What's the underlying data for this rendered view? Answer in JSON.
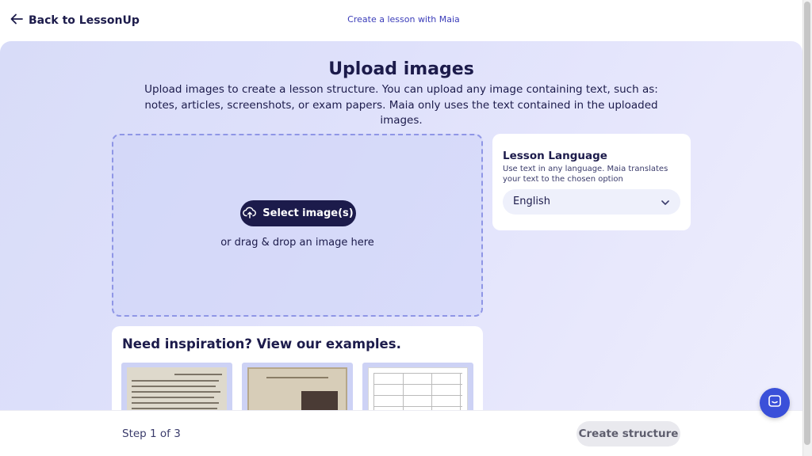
{
  "header": {
    "back_label": "Back to LessonUp",
    "center_link": "Create a lesson with Maia"
  },
  "main": {
    "title": "Upload images",
    "subtitle": "Upload images to create a lesson structure. You can upload any image containing text, such as: notes, articles, screenshots, or exam papers. Maia only uses the text contained in the uploaded images."
  },
  "dropzone": {
    "select_label": "Select image(s)",
    "drop_text": "or drag & drop an image here"
  },
  "language": {
    "title": "Lesson Language",
    "description": "Use text in any language. Maia translates your text to the chosen option",
    "selected": "English"
  },
  "examples": {
    "title": "Need inspiration? View our examples.",
    "items": [
      "sonnet-page-thumbnail",
      "article-page-thumbnail",
      "worksheet-table-thumbnail"
    ]
  },
  "footer": {
    "step_text": "Step 1 of 3",
    "create_label": "Create structure"
  },
  "icons": {
    "back": "arrow-left-icon",
    "upload": "cloud-upload-icon",
    "chevron": "chevron-down-icon",
    "chat": "chat-icon"
  },
  "colors": {
    "primary_dark": "#1c1b4b",
    "accent_link": "#3a3cb9",
    "chat_button": "#3a50d9",
    "dropzone_border": "#8f96e6"
  }
}
